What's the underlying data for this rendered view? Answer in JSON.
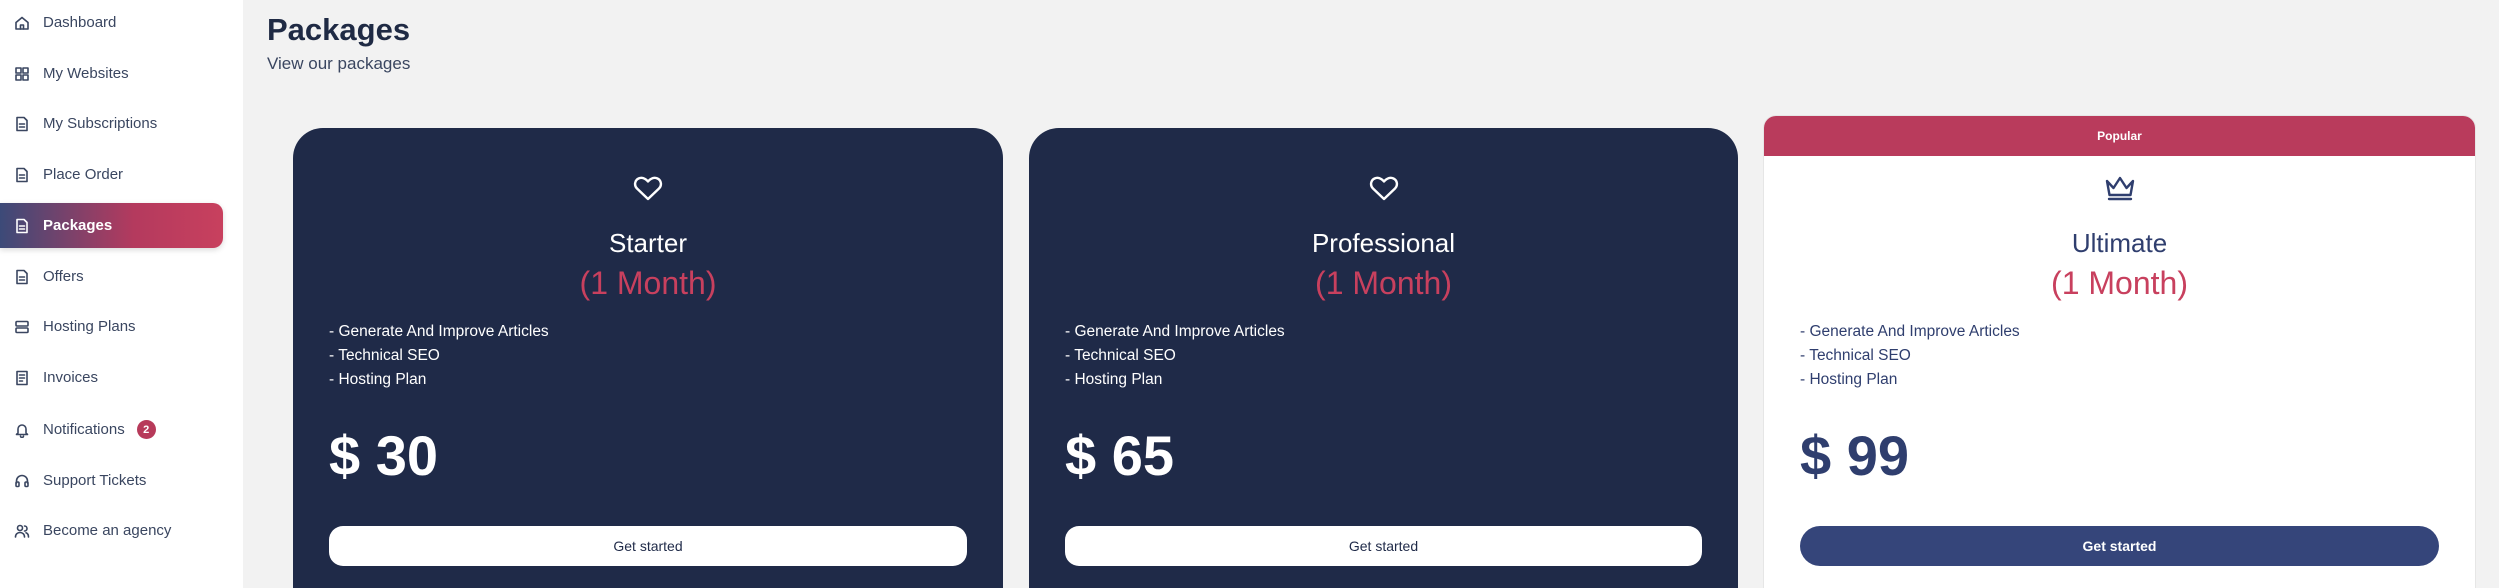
{
  "sidebar": {
    "items": [
      {
        "label": "Dashboard",
        "icon": "home-icon"
      },
      {
        "label": "My Websites",
        "icon": "grid-icon"
      },
      {
        "label": "My Subscriptions",
        "icon": "document-icon"
      },
      {
        "label": "Place Order",
        "icon": "document-icon"
      },
      {
        "label": "Packages",
        "icon": "document-icon",
        "active": true
      },
      {
        "label": "Offers",
        "icon": "document-icon"
      },
      {
        "label": "Hosting Plans",
        "icon": "server-icon"
      },
      {
        "label": "Invoices",
        "icon": "invoice-icon"
      },
      {
        "label": "Notifications",
        "icon": "bell-icon",
        "badge": "2"
      },
      {
        "label": "Support Tickets",
        "icon": "headset-icon"
      },
      {
        "label": "Become an agency",
        "icon": "users-icon"
      }
    ]
  },
  "header": {
    "title": "Packages",
    "subtitle": "View our packages"
  },
  "packages": [
    {
      "name": "Starter",
      "duration": "(1 Month)",
      "features": [
        "- Generate And Improve Articles",
        "- Technical SEO",
        "- Hosting Plan"
      ],
      "price": "$ 30",
      "cta": "Get started",
      "icon": "heart-icon"
    },
    {
      "name": "Professional",
      "duration": "(1 Month)",
      "features": [
        "- Generate And Improve Articles",
        "- Technical SEO",
        "- Hosting Plan"
      ],
      "price": "$ 65",
      "cta": "Get started",
      "icon": "heart-icon"
    },
    {
      "name": "Ultimate",
      "duration": "(1 Month)",
      "features": [
        "- Generate And Improve Articles",
        "- Technical SEO",
        "- Hosting Plan"
      ],
      "price": "$ 99",
      "cta": "Get started",
      "icon": "crown-icon",
      "popular_label": "Popular"
    }
  ],
  "colors": {
    "card_dark": "#1f2a48",
    "accent": "#c8405e",
    "primary": "#35457a"
  }
}
